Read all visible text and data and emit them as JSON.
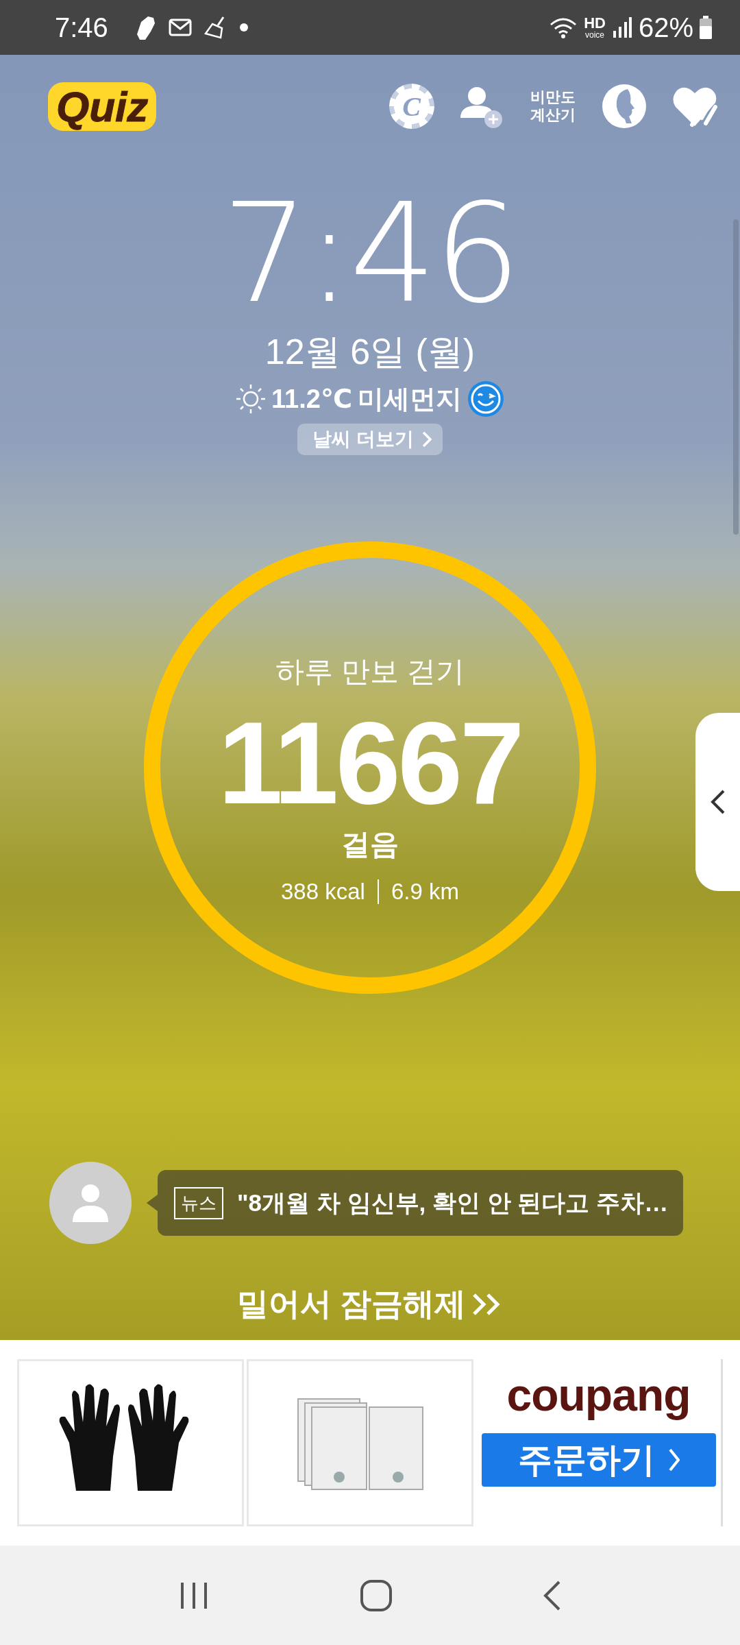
{
  "status_bar": {
    "time": "7:46",
    "hd": "HD",
    "voice": "voice",
    "battery": "62%"
  },
  "header": {
    "logo": "Quiz",
    "coin_letter": "C",
    "bmi_label": "비만도 계산기"
  },
  "clock": {
    "time": "7:46",
    "date": "12월 6일 (월)"
  },
  "weather": {
    "temperature": "11.2℃",
    "dust_label": "미세먼지",
    "more_button": "날씨 더보기"
  },
  "steps": {
    "title": "하루 만보 걷기",
    "count": "11667",
    "unit": "걸음",
    "calories": "388 kcal",
    "distance": "6.9 km",
    "level": 1
  },
  "news": {
    "tag": "뉴스",
    "headline": "\"8개월 차 임신부, 확인 안 된다고 주차…"
  },
  "unlock": {
    "label": "밀어서 잠금해제"
  },
  "ad": {
    "products": [
      {
        "kind": "gloves"
      },
      {
        "kind": "rice-pack"
      }
    ],
    "brand": "coupang",
    "order_button": "주문하기"
  }
}
